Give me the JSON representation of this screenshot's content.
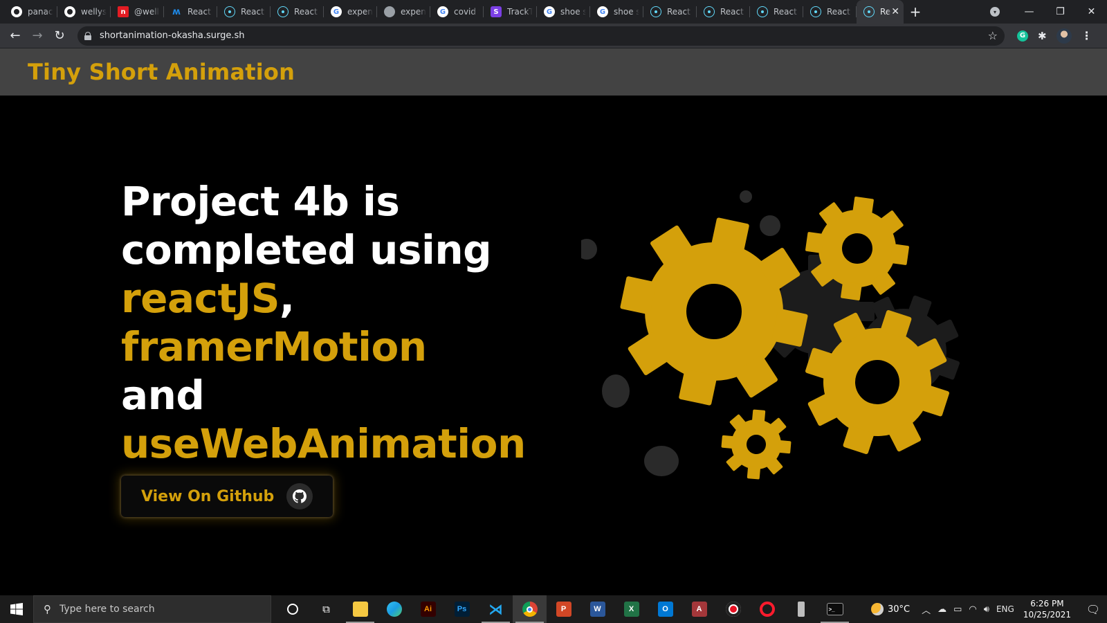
{
  "browser": {
    "tabs": [
      {
        "title": "panacl",
        "icon": "github-icon"
      },
      {
        "title": "wellysh",
        "icon": "github-icon"
      },
      {
        "title": "@welly",
        "icon": "dev-icon"
      },
      {
        "title": "React G",
        "icon": "mui-icon"
      },
      {
        "title": "React A",
        "icon": "react-icon"
      },
      {
        "title": "React A",
        "icon": "react-icon"
      },
      {
        "title": "expens",
        "icon": "google-icon"
      },
      {
        "title": "expens",
        "icon": "globe-icon"
      },
      {
        "title": "covid t",
        "icon": "google-icon"
      },
      {
        "title": "TrackTr",
        "icon": "tracktr-icon"
      },
      {
        "title": "shoe st",
        "icon": "google-icon"
      },
      {
        "title": "shoe st",
        "icon": "google-icon"
      },
      {
        "title": "React A",
        "icon": "react-icon"
      },
      {
        "title": "React A",
        "icon": "react-icon"
      },
      {
        "title": "React A",
        "icon": "react-icon"
      },
      {
        "title": "React A",
        "icon": "react-icon"
      }
    ],
    "active_tab": {
      "title": "Rea",
      "icon": "react-icon"
    },
    "url": "shortanimation-okasha.surge.sh"
  },
  "site": {
    "title": "Tiny Short Animation"
  },
  "hero": {
    "line1": "Project 4b is",
    "line2": "completed using",
    "tech1": "reactJS",
    "comma": ",",
    "tech2": "framerMotion",
    "and": "and",
    "tech3": "useWebAnimation",
    "cta_label": "View On Github",
    "cta_icon": "github-icon"
  },
  "colors": {
    "accent": "#d4a00b",
    "header_bg": "#434343",
    "hero_bg": "#000000"
  },
  "taskbar": {
    "search_placeholder": "Type here to search",
    "apps": [
      "file-explorer",
      "edge",
      "illustrator",
      "photoshop",
      "vscode",
      "chrome",
      "powerpoint",
      "word",
      "excel",
      "outlook",
      "access",
      "recorder",
      "opera",
      "usb-device",
      "terminal"
    ],
    "weather": "30°C",
    "language": "ENG",
    "time": "6:26 PM",
    "date": "10/25/2021"
  }
}
